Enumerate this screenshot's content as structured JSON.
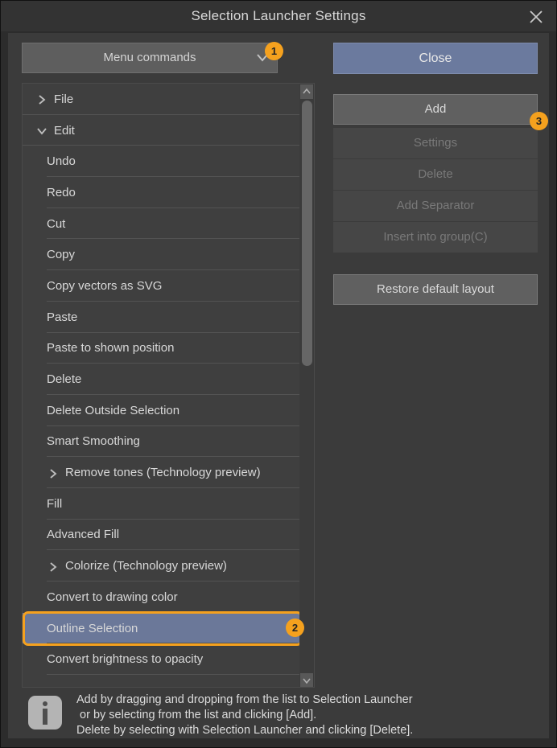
{
  "window": {
    "title": "Selection Launcher Settings",
    "close_icon": "close-icon"
  },
  "toolbar": {
    "dropdown_value": "Menu commands",
    "dropdown_icon": "chevron-down-icon",
    "close_label": "Close"
  },
  "side_buttons": [
    {
      "label": "Add",
      "enabled": true
    },
    {
      "label": "Settings",
      "enabled": false
    },
    {
      "label": "Delete",
      "enabled": false
    },
    {
      "label": "Add Separator",
      "enabled": false
    },
    {
      "label": "Insert into group(C)",
      "enabled": false
    },
    {
      "label": "Restore default layout",
      "enabled": true
    }
  ],
  "list": {
    "items": [
      {
        "label": "File",
        "level": 0,
        "caret": "chevron-right-icon",
        "selected": false
      },
      {
        "label": "Edit",
        "level": 0,
        "caret": "chevron-down-icon",
        "selected": false
      },
      {
        "label": "Undo",
        "level": 1,
        "caret": "",
        "selected": false
      },
      {
        "label": "Redo",
        "level": 1,
        "caret": "",
        "selected": false
      },
      {
        "label": "Cut",
        "level": 1,
        "caret": "",
        "selected": false
      },
      {
        "label": "Copy",
        "level": 1,
        "caret": "",
        "selected": false
      },
      {
        "label": "Copy vectors as SVG",
        "level": 1,
        "caret": "",
        "selected": false
      },
      {
        "label": "Paste",
        "level": 1,
        "caret": "",
        "selected": false
      },
      {
        "label": "Paste to shown position",
        "level": 1,
        "caret": "",
        "selected": false
      },
      {
        "label": "Delete",
        "level": 1,
        "caret": "",
        "selected": false
      },
      {
        "label": "Delete Outside Selection",
        "level": 1,
        "caret": "",
        "selected": false
      },
      {
        "label": "Smart Smoothing",
        "level": 1,
        "caret": "",
        "selected": false
      },
      {
        "label": "Remove tones (Technology preview)",
        "level": 1,
        "caret": "chevron-right-icon",
        "selected": false
      },
      {
        "label": "Fill",
        "level": 1,
        "caret": "",
        "selected": false
      },
      {
        "label": "Advanced Fill",
        "level": 1,
        "caret": "",
        "selected": false
      },
      {
        "label": "Colorize (Technology preview)",
        "level": 1,
        "caret": "chevron-right-icon",
        "selected": false
      },
      {
        "label": "Convert to drawing color",
        "level": 1,
        "caret": "",
        "selected": false
      },
      {
        "label": "Outline Selection",
        "level": 1,
        "caret": "",
        "selected": true
      },
      {
        "label": "Convert brightness to opacity",
        "level": 1,
        "caret": "",
        "selected": false
      }
    ],
    "scroll_up_icon": "chevron-up-icon",
    "scroll_down_icon": "chevron-down-icon"
  },
  "info": {
    "icon": "info-icon",
    "text": "Add by dragging and dropping from the list to Selection Launcher\n or by selecting from the list and clicking [Add].\nDelete by selecting with Selection Launcher and clicking [Delete]."
  },
  "badges": [
    {
      "id": "1",
      "label": "1"
    },
    {
      "id": "2",
      "label": "2"
    },
    {
      "id": "3",
      "label": "3"
    }
  ],
  "colors": {
    "accent_badge": "#f5a11e",
    "selection": "#6b7899",
    "primary_button": "#6b7a9e",
    "panel": "#3b3b3b",
    "titlebar": "#333333"
  }
}
